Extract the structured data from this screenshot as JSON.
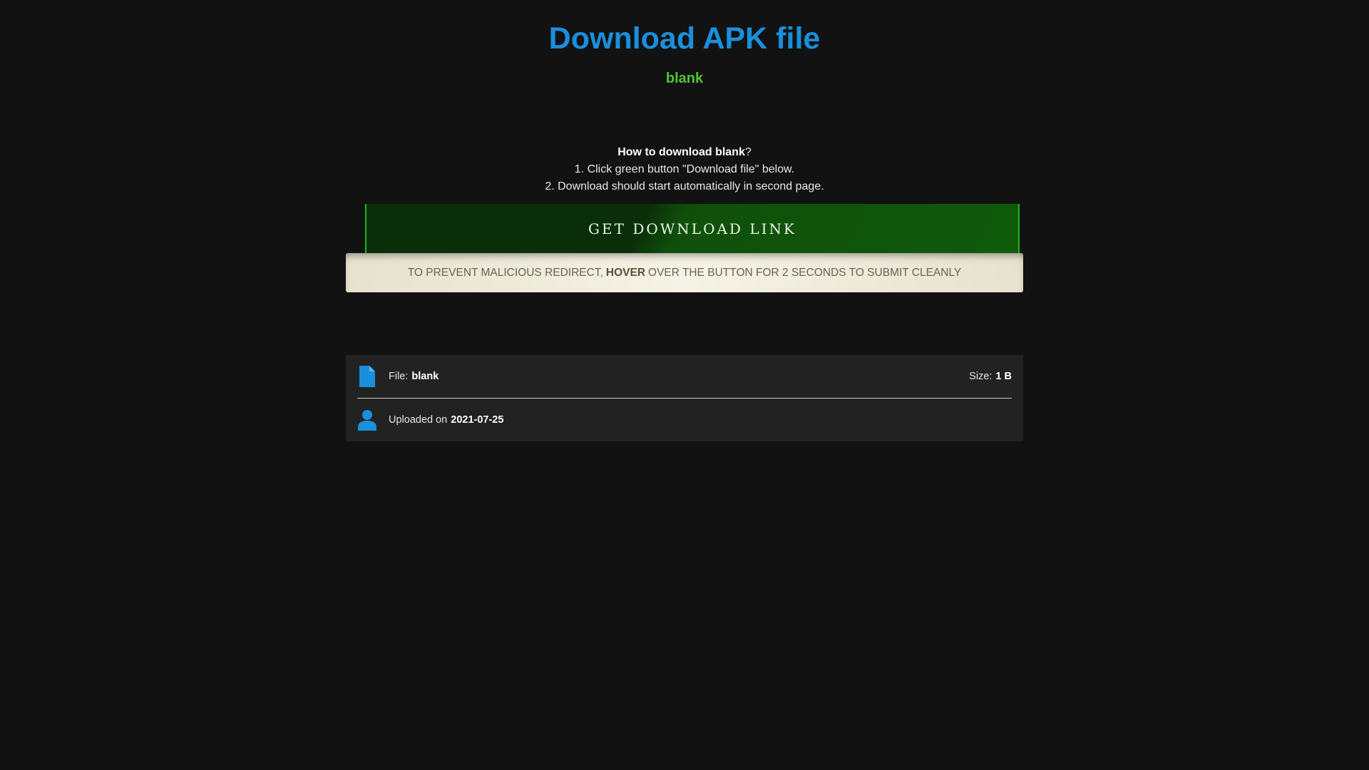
{
  "header": {
    "title": "Download APK file",
    "subtitle": "blank"
  },
  "instructions": {
    "heading_bold": "How to download blank",
    "heading_suffix": "?",
    "step1": "1. Click green button \"Download file\" below.",
    "step2": "2. Download should start automatically in second page."
  },
  "download_button": {
    "label": "GET DOWNLOAD LINK"
  },
  "notice": {
    "prefix": "TO PREVENT MALICIOUS REDIRECT,",
    "emphasis": "HOVER",
    "suffix": "OVER THE BUTTON FOR 2 SECONDS TO SUBMIT CLEANLY"
  },
  "file_info": {
    "file_label": "File:",
    "file_name": "blank",
    "size_label": "Size:",
    "size_value": "1 B",
    "uploaded_label": "Uploaded on",
    "uploaded_date": "2021-07-25"
  },
  "colors": {
    "title": "#1a8fdc",
    "subtitle": "#4fc53a",
    "icons": "#1a8fdc",
    "background": "#121212",
    "panel": "#222222"
  },
  "icons": {
    "file": "file-icon",
    "user": "user-icon"
  }
}
